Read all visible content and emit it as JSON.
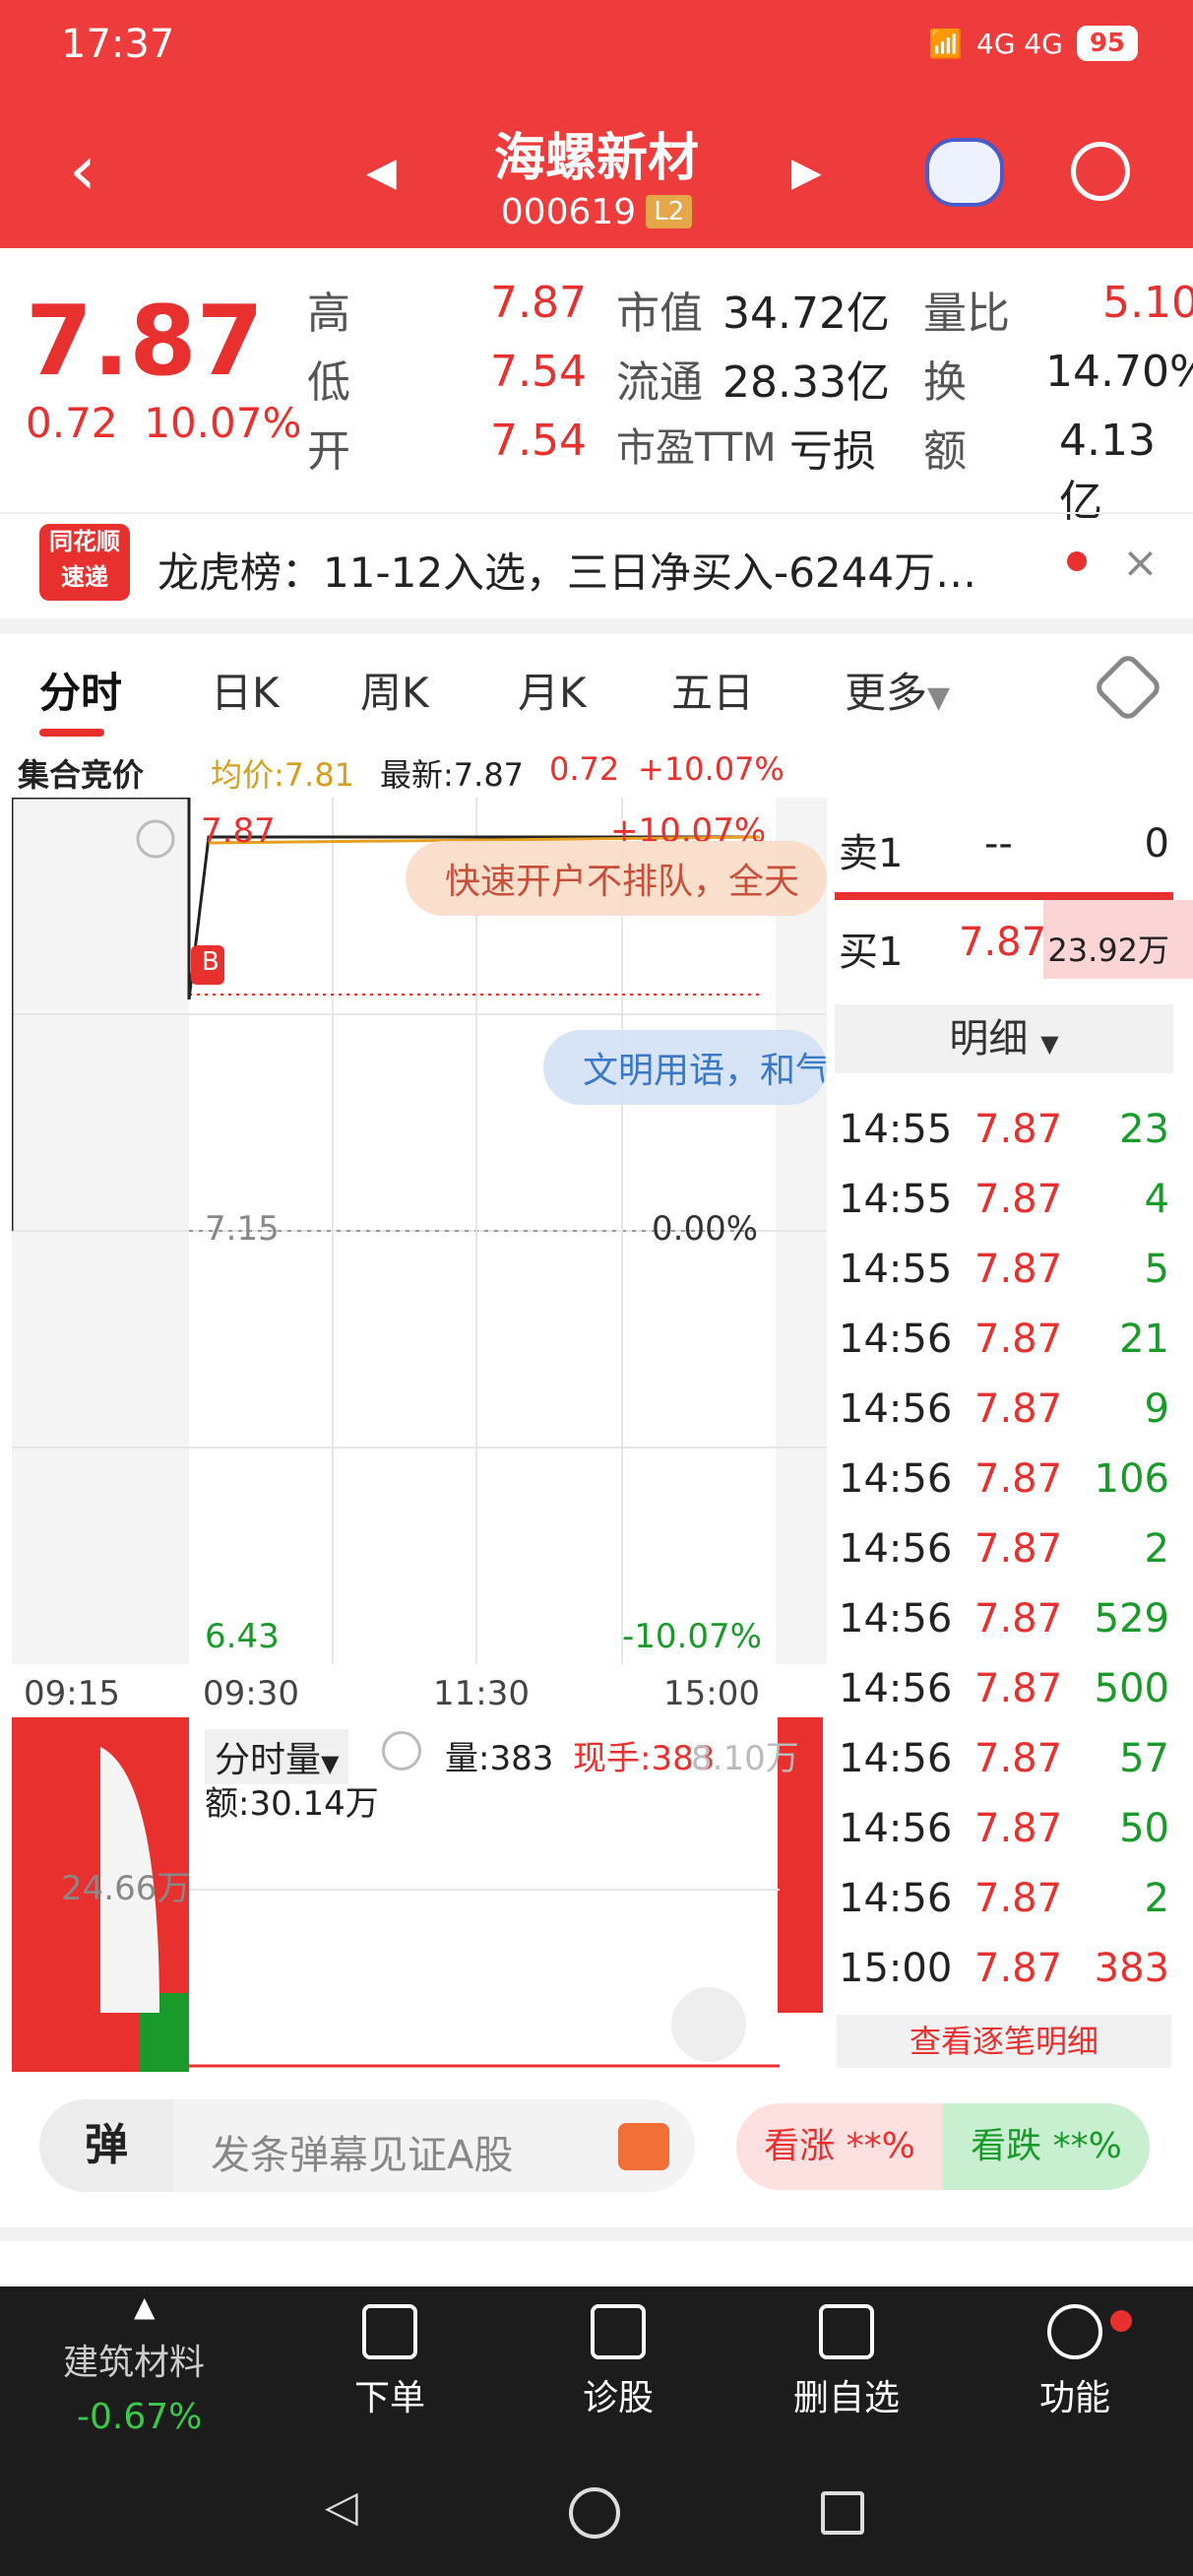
{
  "status": {
    "time": "17:37",
    "network": "4G 4G",
    "battery": "95"
  },
  "header": {
    "title": "海螺新材",
    "code": "000619",
    "badge": "L2"
  },
  "quote": {
    "price": "7.87",
    "change": "0.72",
    "change_pct": "10.07%",
    "rows": [
      {
        "l1": "高",
        "v1": "7.87",
        "l2": "市值",
        "v2": "34.72亿",
        "l3": "量比",
        "v3": "5.10"
      },
      {
        "l1": "低",
        "v1": "7.54",
        "l2": "流通",
        "v2": "28.33亿",
        "l3": "换",
        "v3": "14.70%"
      },
      {
        "l1": "开",
        "v1": "7.54",
        "l2": "市盈TTM",
        "v2": "亏损",
        "l3": "额",
        "v3": "4.13亿"
      }
    ]
  },
  "banner": {
    "logo_top": "同花顺",
    "logo_bottom": "速递",
    "text": "龙虎榜：11-12入选，三日净买入-6244万…"
  },
  "tabs": [
    "分时",
    "日K",
    "周K",
    "月K",
    "五日",
    "更多"
  ],
  "info": {
    "auction": "集合竞价",
    "avg": "均价:7.81",
    "latest": "最新:7.87",
    "chg": "0.72",
    "chg_pct": "+10.07%"
  },
  "chart": {
    "high": "7.87",
    "high_pct": "+10.07%",
    "mid": "7.15",
    "mid_pct": "0.00%",
    "low": "6.43",
    "low_pct": "-10.07%",
    "times": [
      "09:15",
      "09:30",
      "11:30",
      "15:00"
    ],
    "overlay1": "快速开户不排队，全天",
    "overlay2": "文明用语，和气",
    "marker": "B"
  },
  "volume": {
    "label": "分时量",
    "vol": "量:383",
    "now": "现手:383",
    "amount": "额:30.14万",
    "left_val": "24.66万",
    "right_val": "8.10万"
  },
  "orderbook": {
    "sell": {
      "label": "卖1",
      "price": "--",
      "vol": "0"
    },
    "buy": {
      "label": "买1",
      "price": "7.87",
      "vol": "23.92万"
    },
    "detail_label": "明细",
    "rows": [
      {
        "t": "14:55",
        "p": "7.87",
        "v": "23"
      },
      {
        "t": "14:55",
        "p": "7.87",
        "v": "4"
      },
      {
        "t": "14:55",
        "p": "7.87",
        "v": "5"
      },
      {
        "t": "14:56",
        "p": "7.87",
        "v": "21"
      },
      {
        "t": "14:56",
        "p": "7.87",
        "v": "9"
      },
      {
        "t": "14:56",
        "p": "7.87",
        "v": "106"
      },
      {
        "t": "14:56",
        "p": "7.87",
        "v": "2"
      },
      {
        "t": "14:56",
        "p": "7.87",
        "v": "529"
      },
      {
        "t": "14:56",
        "p": "7.87",
        "v": "500"
      },
      {
        "t": "14:56",
        "p": "7.87",
        "v": "57"
      },
      {
        "t": "14:56",
        "p": "7.87",
        "v": "50"
      },
      {
        "t": "14:56",
        "p": "7.87",
        "v": "2"
      },
      {
        "t": "15:00",
        "p": "7.87",
        "v": "383"
      }
    ],
    "link": "查看逐笔明细"
  },
  "danmu": {
    "button": "弹",
    "placeholder": "发条弹幕见证A股",
    "bull": "看涨 **%",
    "bear": "看跌 **%"
  },
  "bottom_nav": {
    "sector": "建筑材料",
    "sector_chg": "-0.67%",
    "items": [
      "下单",
      "诊股",
      "删自选",
      "功能"
    ]
  },
  "colors": {
    "header": "#ee3b3b",
    "up": "#e8312f",
    "down": "#1a9a2a"
  }
}
